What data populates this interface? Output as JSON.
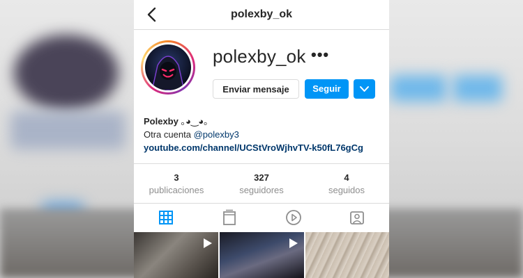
{
  "header": {
    "title": "polexby_ok"
  },
  "profile": {
    "username": "polexby_ok",
    "more_label": "•••",
    "buttons": {
      "message": "Enviar mensaje",
      "follow": "Seguir"
    }
  },
  "bio": {
    "name": "Polexby",
    "name_emoticon": "｡◕‿◕｡",
    "line2_prefix": "Otra cuenta",
    "line2_mention": "@polexby3",
    "link": "youtube.com/channel/UCStVroWjhvTV-k50fL76gCg"
  },
  "stats": [
    {
      "value": "3",
      "label": "publicaciones"
    },
    {
      "value": "327",
      "label": "seguidores"
    },
    {
      "value": "4",
      "label": "seguidos"
    }
  ],
  "tabs": [
    {
      "icon": "grid-icon",
      "active": true
    },
    {
      "icon": "igtv-icon",
      "active": false
    },
    {
      "icon": "play-circle-icon",
      "active": false
    },
    {
      "icon": "tagged-icon",
      "active": false
    }
  ],
  "posts": [
    {
      "type": "video",
      "icon": "play-icon"
    },
    {
      "type": "video",
      "icon": "play-icon"
    },
    {
      "type": "image"
    }
  ],
  "colors": {
    "accent": "#0095f6",
    "link": "#00376b",
    "secondary_text": "#8e8e8e",
    "divider": "#dbdbdb"
  }
}
